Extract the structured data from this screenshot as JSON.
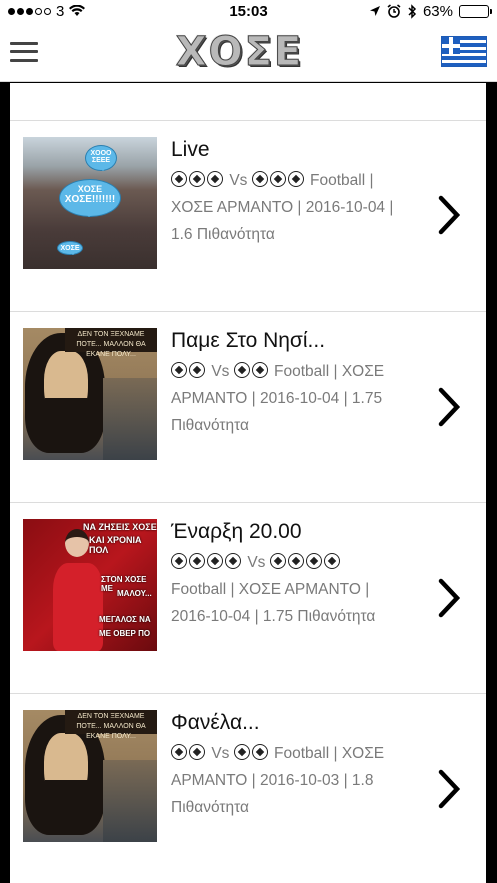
{
  "status_bar": {
    "carrier": "3",
    "time": "15:03",
    "battery": "63%",
    "battery_level": 0.63
  },
  "nav": {
    "logo": "ΧΟΣΕ"
  },
  "items": [
    {
      "title": "Live",
      "balls_a": 3,
      "vs": "Vs",
      "balls_b": 3,
      "line1_rest": "Football |",
      "line2": "ΧΟΣΕ ΑΡΜΑΝΤΟ | 2016-10-04 |",
      "line3": "1.6 Πιθανότητα",
      "thumb_texts": [
        "ΧΟΣΕ",
        "ΧΟΣΕ!!!!!!!",
        "ΧΟΣΕ",
        "ΧΟΟΟ ΣΕΕΕ"
      ]
    },
    {
      "title": "Παμε Στο Νησί...",
      "balls_a": 2,
      "vs": "Vs",
      "balls_b": 2,
      "line1_rest": "Football | ΧΟΣΕ",
      "line2": "ΑΡΜΑΝΤΟ | 2016-10-04 | 1.75",
      "line3": "Πιθανότητα",
      "thumb_texts": [
        "ΔΕΝ ΤΟΝ ΞΕΧΝΑΜΕ ΠΟΤΕ... ΜΑΛΛΟΝ ΘΑ ΕΚΑΝΕ ΠΟΛΥ..."
      ]
    },
    {
      "title": "Έναρξη 20.00",
      "balls_a": 4,
      "vs": "Vs",
      "balls_b": 4,
      "line1_rest": "",
      "line2": "Football | ΧΟΣΕ ΑΡΜΑΝΤΟ |",
      "line3": "2016-10-04 | 1.75 Πιθανότητα",
      "thumb_texts": [
        "ΝΑ ΖΗΣΕΙΣ ΧΟΣΕ",
        "ΚΑΙ ΧΡΟΝΙΑ ΠΟΛ",
        "ΣΤΟΝ ΧΟΣΕ ΜΕ",
        "ΜΑΛΟΥ...",
        "ΜΕΓΑΛΟΣ ΝΑ",
        "ΜΕ ΟΒΕΡ ΠΟ"
      ]
    },
    {
      "title": "Φανέλα...",
      "balls_a": 2,
      "vs": "Vs",
      "balls_b": 2,
      "line1_rest": "Football | ΧΟΣΕ",
      "line2": "ΑΡΜΑΝΤΟ | 2016-10-03 | 1.8",
      "line3": "Πιθανότητα",
      "thumb_texts": [
        "ΔΕΝ ΤΟΝ ΞΕΧΝΑΜΕ ΠΟΤΕ... ΜΑΛΛΟΝ ΘΑ ΕΚΑΝΕ ΠΟΛΥ..."
      ]
    }
  ]
}
